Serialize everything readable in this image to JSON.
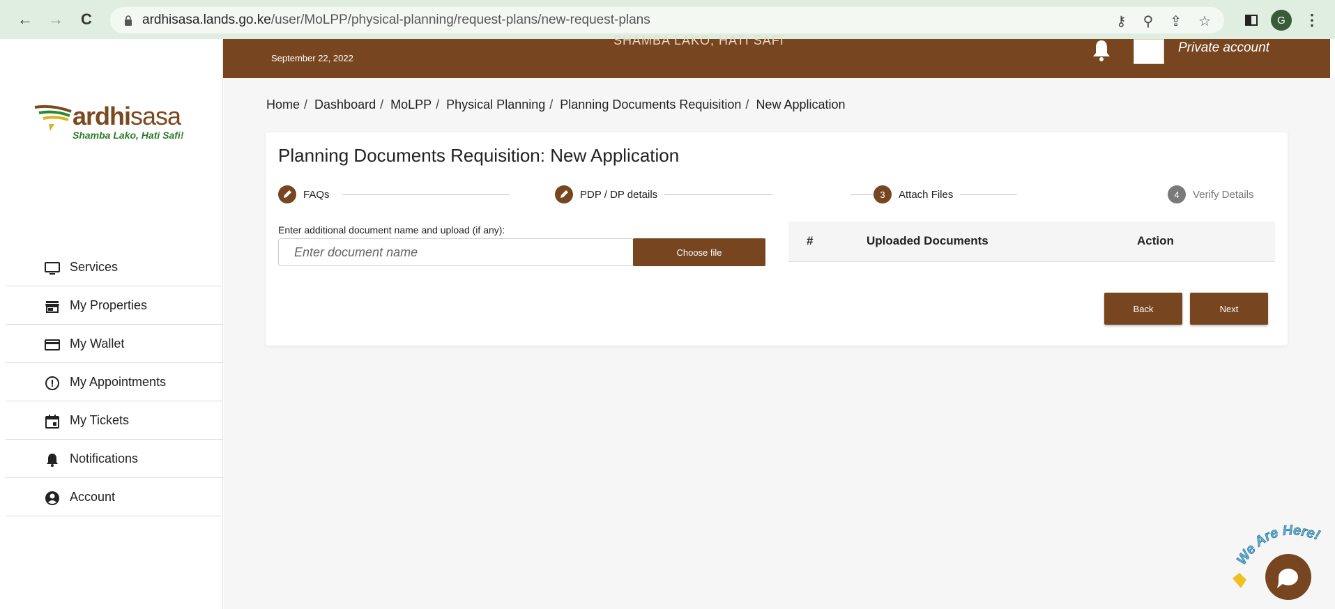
{
  "browser": {
    "url_domain": "ardhisasa.lands.go.ke",
    "url_path": "/user/MoLPP/physical-planning/request-plans/new-request-plans",
    "profile_initial": "G"
  },
  "header": {
    "date": "September 22, 2022",
    "tagline": "SHAMBA LAKO, HATI SAFI",
    "account_label": "Private account"
  },
  "logo": {
    "brand_bold": "ardhi",
    "brand_light": "sasa",
    "slogan": "Shamba Lako, Hati Safi!"
  },
  "sidebar": {
    "items": [
      {
        "label": "Services",
        "icon": "monitor-icon"
      },
      {
        "label": "My Properties",
        "icon": "store-icon"
      },
      {
        "label": "My Wallet",
        "icon": "credit-card-icon"
      },
      {
        "label": "My Appointments",
        "icon": "alert-circle-icon"
      },
      {
        "label": "My Tickets",
        "icon": "calendar-icon"
      },
      {
        "label": "Notifications",
        "icon": "bell-icon"
      },
      {
        "label": "Account",
        "icon": "account-circle-icon"
      }
    ]
  },
  "breadcrumb": [
    "Home",
    "Dashboard",
    "MoLPP",
    "Physical Planning",
    "Planning Documents Requisition",
    "New Application"
  ],
  "card": {
    "title": "Planning Documents Requisition: New Application",
    "steps": [
      {
        "label": "FAQs",
        "state": "done"
      },
      {
        "label": "PDP / DP details",
        "state": "done"
      },
      {
        "number": "3",
        "label": "Attach Files",
        "state": "active"
      },
      {
        "number": "4",
        "label": "Verify Details",
        "state": "inactive"
      }
    ],
    "upload_label": "Enter additional document name and upload (if any):",
    "doc_name_placeholder": "Enter document name",
    "choose_file_label": "Choose file",
    "table_headers": [
      "#",
      "Uploaded Documents",
      "Action"
    ],
    "back_label": "Back",
    "next_label": "Next"
  },
  "chat": {
    "label": "We Are Here!"
  },
  "colors": {
    "brand_brown": "#774620",
    "browser_green": "#dfeee0"
  }
}
